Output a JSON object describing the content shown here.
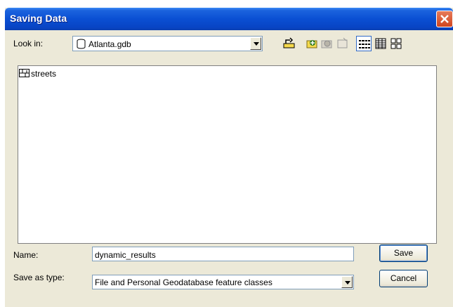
{
  "dialog": {
    "title": "Saving Data"
  },
  "look_in": {
    "label": "Look in:",
    "value": "Atlanta.gdb",
    "icon": "database-icon"
  },
  "toolbar": {
    "buttons": [
      {
        "name": "up-one-level-icon"
      },
      {
        "name": "connect-folder-icon"
      },
      {
        "name": "disconnect-icon"
      },
      {
        "name": "new-item-icon"
      },
      {
        "name": "list-view-icon"
      },
      {
        "name": "details-view-icon"
      },
      {
        "name": "thumbnails-view-icon"
      }
    ]
  },
  "list": {
    "items": [
      {
        "label": "streets",
        "icon": "feature-dataset-icon"
      }
    ]
  },
  "name": {
    "label": "Name:",
    "value": "dynamic_results"
  },
  "save_as_type": {
    "label": "Save as type:",
    "value": "File and Personal Geodatabase feature classes"
  },
  "buttons": {
    "save": "Save",
    "cancel": "Cancel"
  },
  "colors": {
    "title_bar": "#0a4fd3",
    "close_button": "#d0451f",
    "face": "#ece9d8"
  }
}
